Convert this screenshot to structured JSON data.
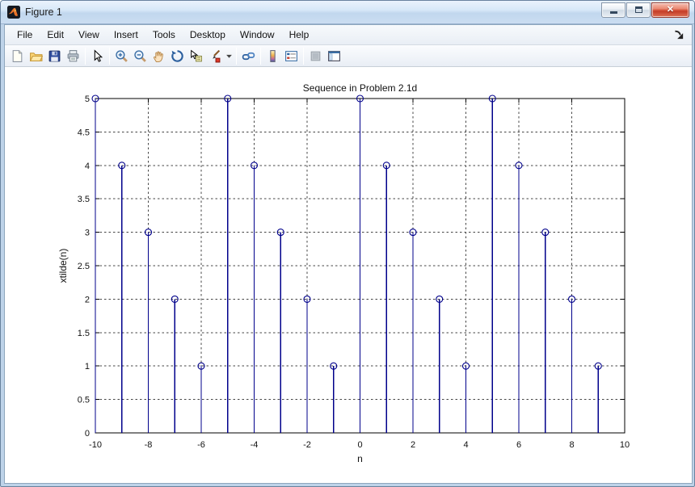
{
  "window": {
    "title": "Figure 1",
    "icon": "matlab-logo",
    "controls": [
      "minimize",
      "maximize",
      "close"
    ],
    "close_glyph": "✕"
  },
  "menubar": {
    "items": [
      "File",
      "Edit",
      "View",
      "Insert",
      "Tools",
      "Desktop",
      "Window",
      "Help"
    ],
    "dock_icon": "dock-figure-icon"
  },
  "toolbar": {
    "groups": [
      [
        "new-document",
        "open-folder",
        "save",
        "print"
      ],
      [
        "pointer"
      ],
      [
        "zoom-in",
        "zoom-out",
        "pan",
        "rotate-3d",
        "data-cursor",
        "brush",
        "brush-dropdown"
      ],
      [
        "link-plot"
      ],
      [
        "colorbar",
        "legend"
      ],
      [
        "hide-plot-tools",
        "show-plot-tools"
      ]
    ]
  },
  "chart_data": {
    "type": "stem",
    "title": "Sequence in Problem 2.1d",
    "xlabel": "n",
    "ylabel": "xtilde(n)",
    "xlim": [
      -10,
      10
    ],
    "ylim": [
      0,
      5
    ],
    "xticks": [
      -10,
      -8,
      -6,
      -4,
      -2,
      0,
      2,
      4,
      6,
      8,
      10
    ],
    "yticks": [
      0,
      0.5,
      1,
      1.5,
      2,
      2.5,
      3,
      3.5,
      4,
      4.5,
      5
    ],
    "x": [
      -10,
      -9,
      -8,
      -7,
      -6,
      -5,
      -4,
      -3,
      -2,
      -1,
      0,
      1,
      2,
      3,
      4,
      5,
      6,
      7,
      8,
      9
    ],
    "values": [
      5,
      4,
      3,
      2,
      1,
      5,
      4,
      3,
      2,
      1,
      5,
      4,
      3,
      2,
      1,
      5,
      4,
      3,
      2,
      1
    ],
    "grid": true,
    "marker": "o",
    "legend_position": "none",
    "colors": {
      "stem": "#00008B",
      "axis": "#000000",
      "grid": "#444444",
      "text": "#111111"
    }
  }
}
